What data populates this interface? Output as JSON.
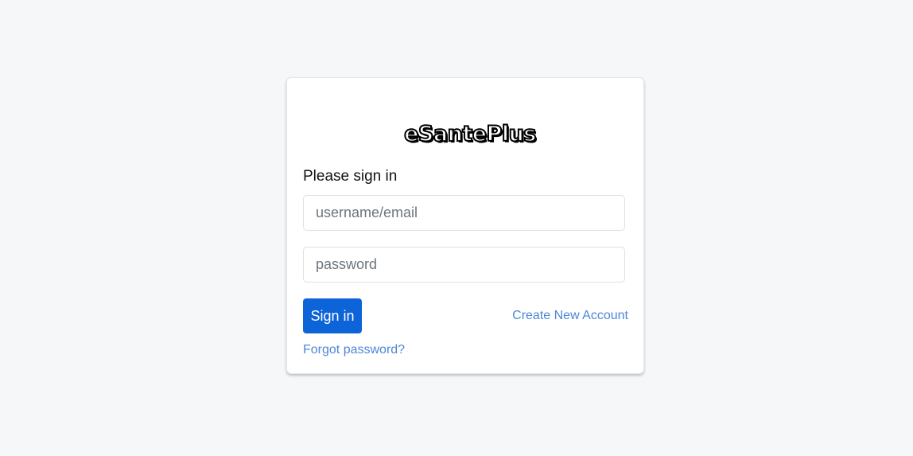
{
  "brand": {
    "logo_text": "eSantePlus"
  },
  "login": {
    "heading": "Please sign in",
    "username_placeholder": "username/email",
    "password_placeholder": "password",
    "submit_label": "Sign in",
    "create_account_label": "Create New Account",
    "forgot_password_label": "Forgot password?"
  },
  "colors": {
    "page_background": "#f5f7f8",
    "primary_button": "#0d63d8",
    "link": "#4d86d8"
  }
}
